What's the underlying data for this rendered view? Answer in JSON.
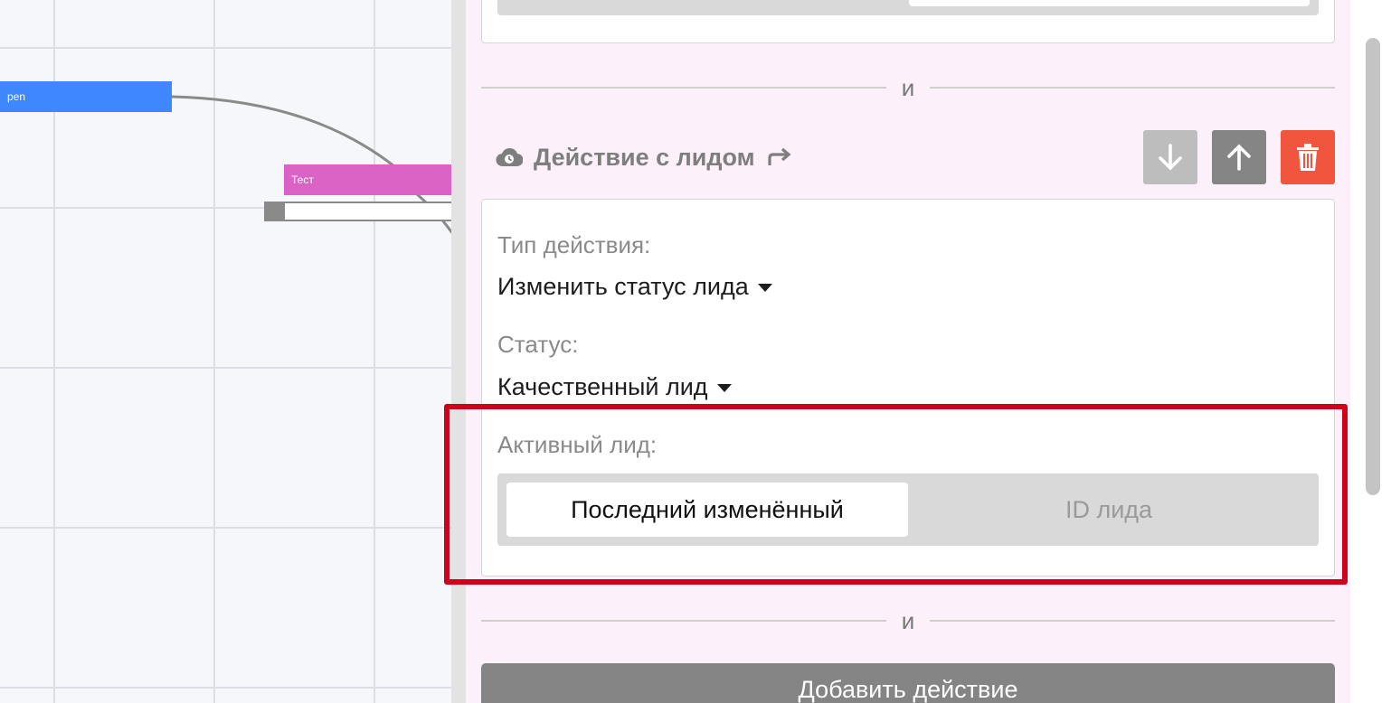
{
  "canvas": {
    "nodes": [
      {
        "label": "pen",
        "color": "#3f87ff"
      },
      {
        "label": "",
        "color": "#3f87ff"
      },
      {
        "label": "Тест",
        "color": "#db63c5"
      },
      {
        "label": "",
        "color": "#db63c5"
      }
    ]
  },
  "separators": {
    "and_label": "и"
  },
  "action": {
    "title": "Действие с лидом",
    "icons": {
      "cloud": "cloud-clock-icon",
      "redirect": "redirect-arrow-icon",
      "down": "arrow-down-icon",
      "up": "arrow-up-icon",
      "delete": "trash-icon"
    },
    "action_type_label": "Тип действия:",
    "action_type_value": "Изменить статус лида",
    "status_label": "Статус:",
    "status_value": "Качественный лид",
    "active_lead_label": "Активный лид:",
    "active_lead_options": [
      "Последний изменённый",
      "ID лида"
    ],
    "active_lead_selected": "Последний изменённый"
  },
  "footer": {
    "add_action_label": "Добавить действие"
  },
  "colors": {
    "accent_delete": "#f2553e",
    "highlight": "#d0021b",
    "panel_bg": "#fcf0fa"
  }
}
